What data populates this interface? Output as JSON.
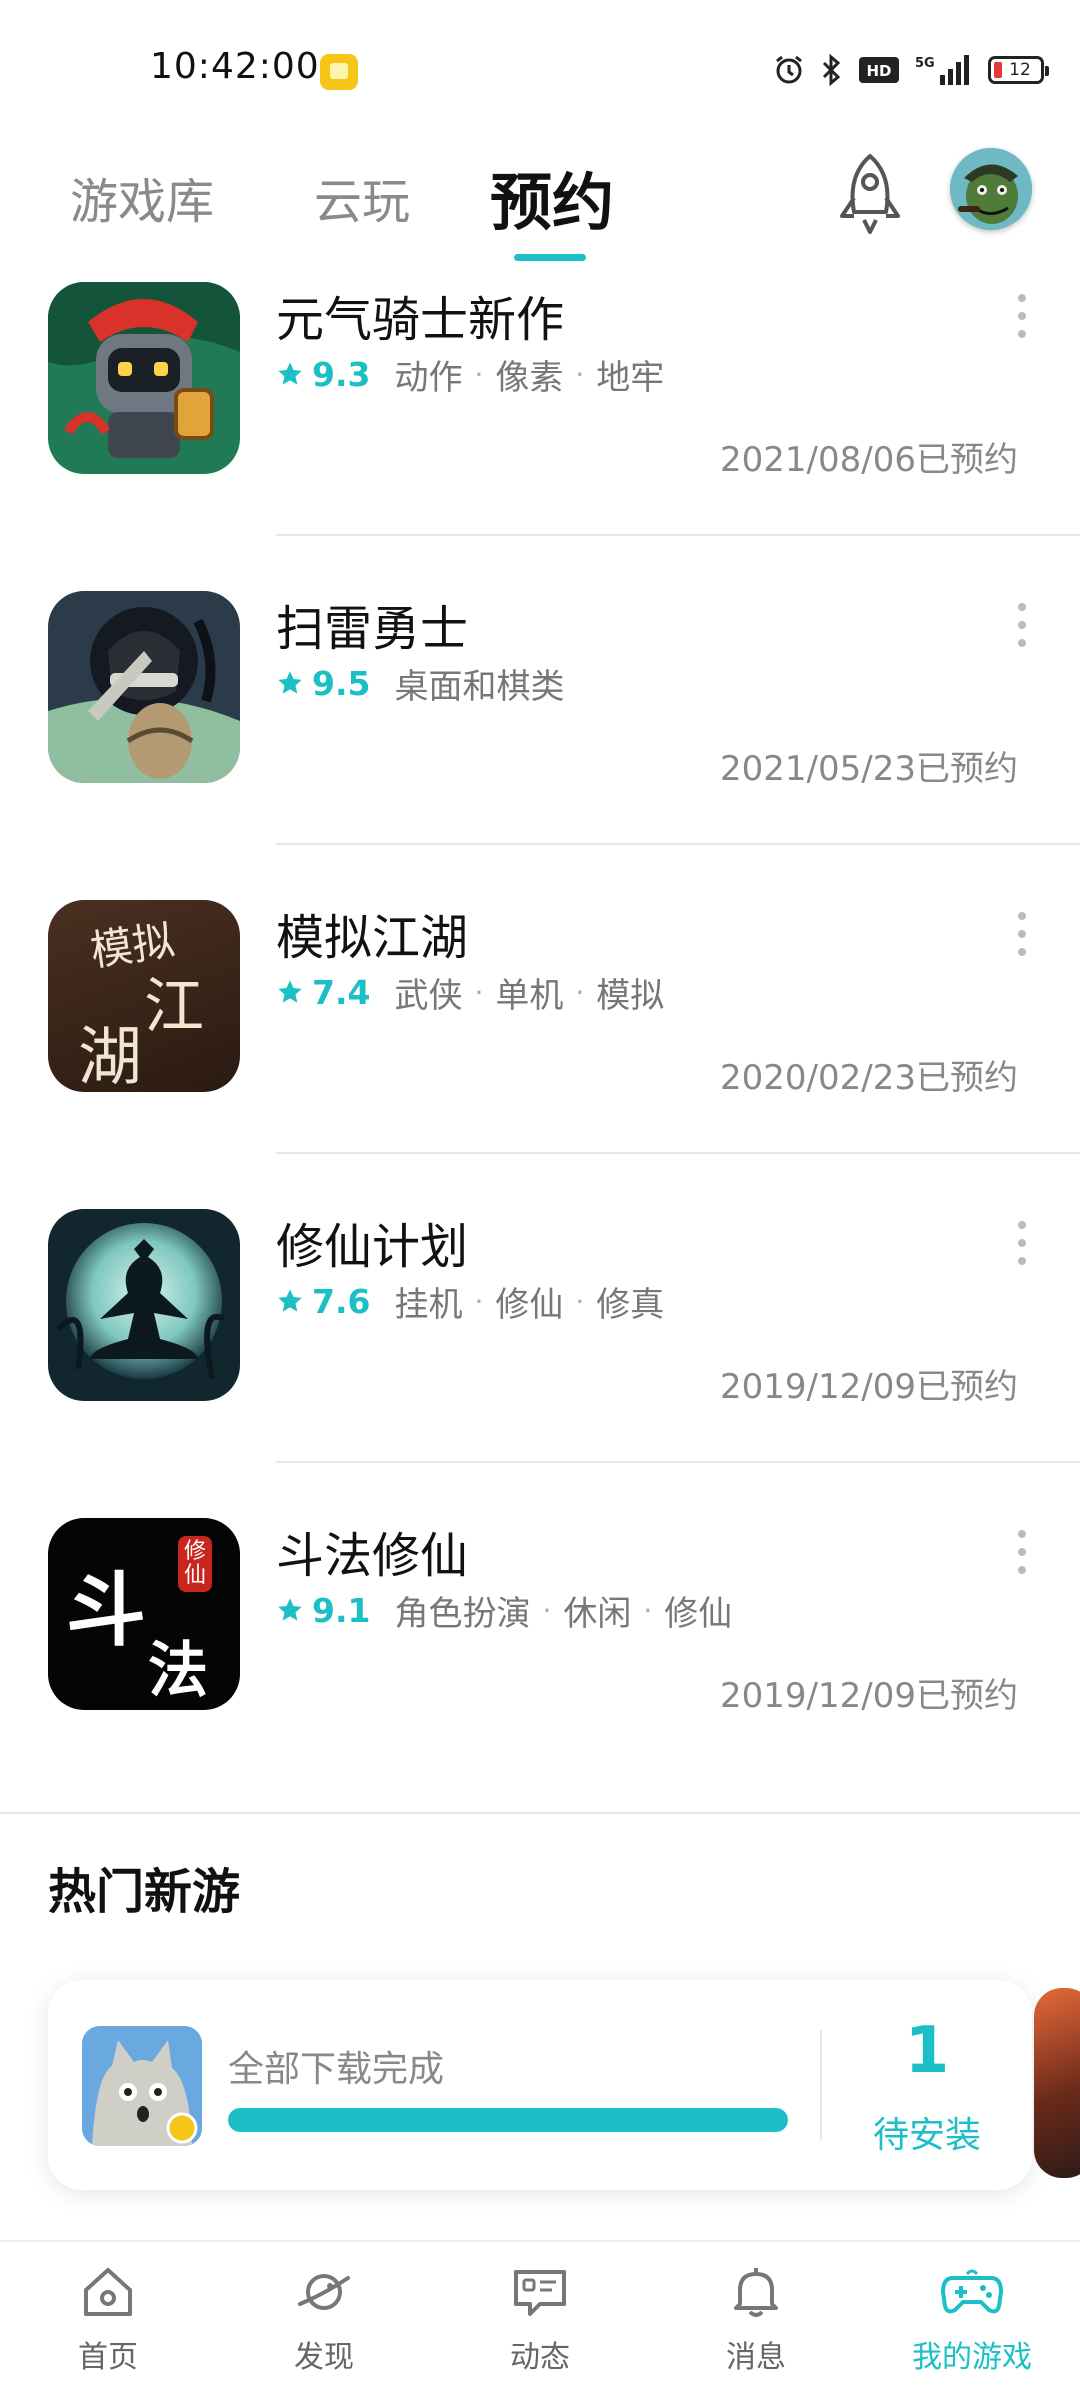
{
  "status_bar": {
    "time": "10:42:00",
    "network": "5G",
    "battery": "12"
  },
  "top_tabs": [
    {
      "label": "游戏库"
    },
    {
      "label": "云玩"
    },
    {
      "label": "预约"
    }
  ],
  "games": [
    {
      "title": "元气骑士新作",
      "score": "9.3",
      "tags": [
        "动作",
        "像素",
        "地牢"
      ],
      "date": "2021/08/06已预约"
    },
    {
      "title": "扫雷勇士",
      "score": "9.5",
      "tags": [
        "桌面和棋类"
      ],
      "date": "2021/05/23已预约"
    },
    {
      "title": "模拟江湖",
      "score": "7.4",
      "tags": [
        "武侠",
        "单机",
        "模拟"
      ],
      "date": "2020/02/23已预约"
    },
    {
      "title": "修仙计划",
      "score": "7.6",
      "tags": [
        "挂机",
        "修仙",
        "修真"
      ],
      "date": "2019/12/09已预约"
    },
    {
      "title": "斗法修仙",
      "score": "9.1",
      "tags": [
        "角色扮演",
        "休闲",
        "修仙"
      ],
      "date": "2019/12/09已预约"
    }
  ],
  "icon_text": {
    "jianghu_1": "模拟",
    "jianghu_2": "江",
    "jianghu_3": "湖",
    "doufa_1": "斗",
    "doufa_2": "法",
    "doufa_badge": "修仙"
  },
  "hot_section": {
    "title": "热门新游"
  },
  "download_card": {
    "label": "全部下载完成",
    "progress": 1.0,
    "count": "1",
    "count_label": "待安装"
  },
  "bottom_nav": [
    {
      "label": "首页",
      "icon": "home-icon"
    },
    {
      "label": "发现",
      "icon": "planet-icon"
    },
    {
      "label": "动态",
      "icon": "message-card-icon"
    },
    {
      "label": "消息",
      "icon": "bell-icon"
    },
    {
      "label": "我的游戏",
      "icon": "gamepad-icon"
    }
  ],
  "colors": {
    "accent": "#1bbfc5",
    "text_primary": "#111111",
    "text_secondary": "#888888"
  }
}
